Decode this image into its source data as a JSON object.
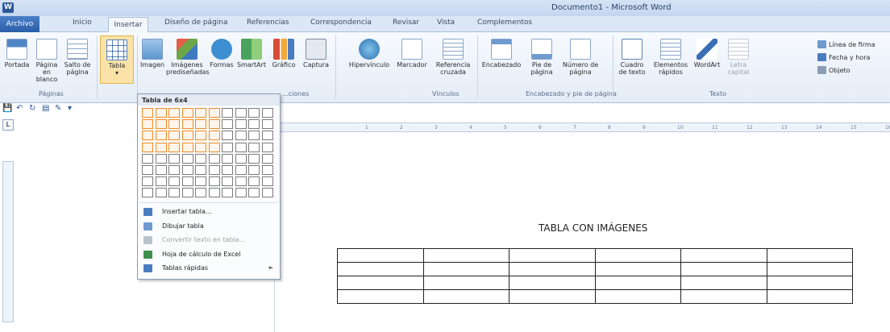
{
  "window": {
    "title": "Documento1 - Microsoft Word",
    "app_icon_letter": "W"
  },
  "tabs": [
    "Archivo",
    "Inicio",
    "Insertar",
    "Diseño de página",
    "Referencias",
    "Correspondencia",
    "Revisar",
    "Vista",
    "Complementos"
  ],
  "ribbon": {
    "paginas": {
      "portada": "Portada",
      "pagina_blanco": "Página en blanco",
      "salto": "Salto de página",
      "label": "Páginas"
    },
    "tablas": {
      "tabla": "Tabla"
    },
    "ilustraciones": {
      "imagen": "Imagen",
      "predisenadas": "Imágenes prediseñadas",
      "formas": "Formas",
      "smartart": "SmartArt",
      "grafico": "Gráfico",
      "captura": "Captura",
      "label": "...ciones"
    },
    "vinculos": {
      "hipervinculo": "Hipervínculo",
      "marcador": "Marcador",
      "referencia": "Referencia cruzada",
      "label": "Vínculos"
    },
    "encabezado": {
      "encabezado": "Encabezado",
      "pie": "Pie de página",
      "numero": "Número de página",
      "label": "Encabezado y pie de página"
    },
    "texto": {
      "cuadro": "Cuadro de texto",
      "elementos": "Elementos rápidos",
      "wordart": "WordArt",
      "letra": "Letra capital",
      "label": "Texto"
    },
    "right": {
      "linea_firma": "Línea de firma",
      "fecha": "Fecha y hora",
      "objeto": "Objeto"
    }
  },
  "dropdown": {
    "title": "Tabla de 6x4",
    "grid_cols": 10,
    "grid_rows": 8,
    "selected_cols": 6,
    "selected_rows": 4,
    "items": [
      {
        "label": "Insertar tabla...",
        "disabled": false
      },
      {
        "label": "Dibujar tabla",
        "disabled": false
      },
      {
        "label": "Convertir texto en tabla...",
        "disabled": true
      },
      {
        "label": "Hoja de cálculo de Excel",
        "disabled": false
      },
      {
        "label": "Tablas rápidas",
        "disabled": false,
        "arrow": "►"
      }
    ]
  },
  "document": {
    "heading": "TABLA CON IMÁGENES",
    "table_rows": 4,
    "table_cols": 6
  },
  "colors": {
    "accent": "#2b579a",
    "selection": "#f08a24"
  }
}
